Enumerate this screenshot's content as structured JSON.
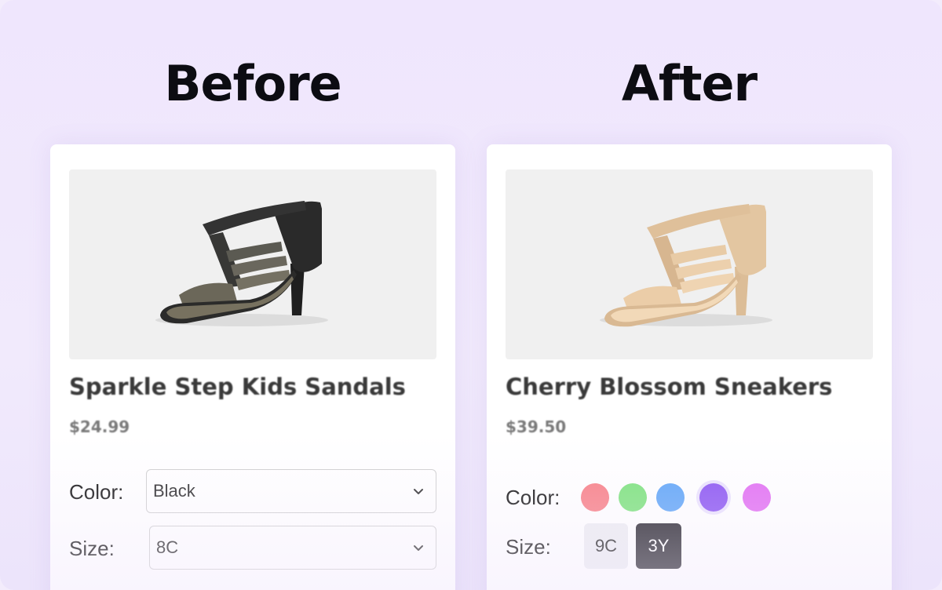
{
  "headings": {
    "before": "Before",
    "after": "After"
  },
  "before_card": {
    "product_name": "Sparkle Step Kids Sandals",
    "price": "$24.99",
    "color_label": "Color:",
    "color_value": "Black",
    "size_label": "Size:",
    "size_value": "8C",
    "shoe_color": "#3b3b38"
  },
  "after_card": {
    "product_name": "Cherry Blossom Sneakers",
    "price": "$39.50",
    "color_label": "Color:",
    "swatches": [
      {
        "name": "red",
        "color": "#f87f86",
        "selected": false
      },
      {
        "name": "green",
        "color": "#7ce37c",
        "selected": false
      },
      {
        "name": "blue",
        "color": "#5fa5f7",
        "selected": false
      },
      {
        "name": "purple",
        "color": "#8b55f1",
        "selected": true
      },
      {
        "name": "magenta",
        "color": "#e26ff2",
        "selected": false
      }
    ],
    "size_label": "Size:",
    "sizes": [
      {
        "label": "9C",
        "selected": false
      },
      {
        "label": "3Y",
        "selected": true
      }
    ],
    "shoe_color": "#e7c9a4"
  }
}
